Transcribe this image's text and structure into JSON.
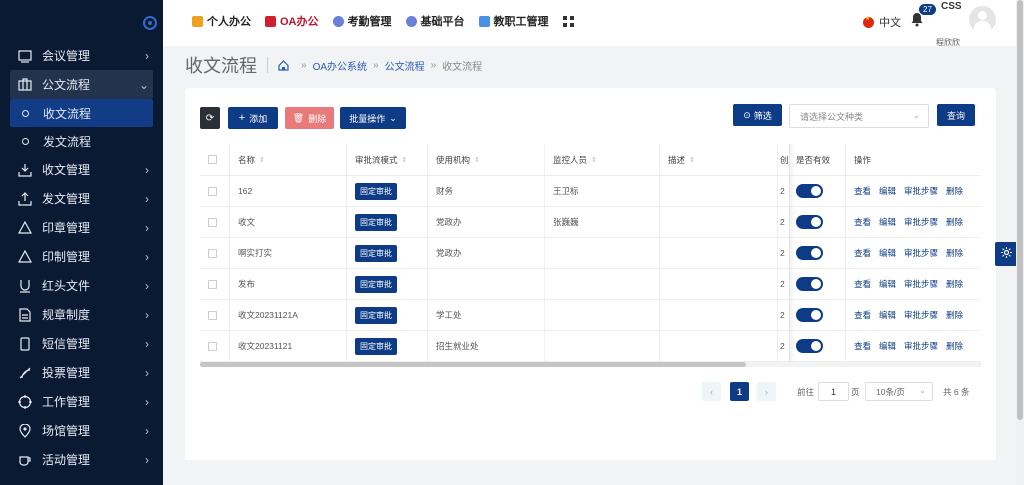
{
  "nav": {
    "items": [
      {
        "label": "个人办公",
        "icon": "briefcase-icon",
        "color": "#f0a020"
      },
      {
        "label": "OA办公",
        "icon": "office-icon",
        "color": "#d02030"
      },
      {
        "label": "考勤管理",
        "icon": "person-icon",
        "color": "#6a7fd8"
      },
      {
        "label": "基础平台",
        "icon": "platform-icon",
        "color": "#6a7fd8"
      },
      {
        "label": "教职工管理",
        "icon": "staff-icon",
        "color": "#4a90e2"
      }
    ],
    "language": "中文",
    "notifications": "27",
    "app_label": "CSS",
    "username": "程欣欣"
  },
  "sidebar": {
    "items": [
      {
        "label": "会议管理",
        "icon": "meeting-icon"
      },
      {
        "label": "公文流程",
        "icon": "document-flow-icon"
      },
      {
        "label": "收文管理",
        "icon": "inbox-icon"
      },
      {
        "label": "发文管理",
        "icon": "upload-icon"
      },
      {
        "label": "印章管理",
        "icon": "seal-icon"
      },
      {
        "label": "印制管理",
        "icon": "print-icon"
      },
      {
        "label": "红头文件",
        "icon": "red-header-icon"
      },
      {
        "label": "规章制度",
        "icon": "rules-icon"
      },
      {
        "label": "短信管理",
        "icon": "sms-icon"
      },
      {
        "label": "投票管理",
        "icon": "vote-icon"
      },
      {
        "label": "工作管理",
        "icon": "work-icon"
      },
      {
        "label": "场馆管理",
        "icon": "venue-icon"
      },
      {
        "label": "活动管理",
        "icon": "activity-icon"
      }
    ],
    "submenu": [
      "收文流程",
      "发文流程"
    ]
  },
  "page": {
    "title": "收文流程",
    "breadcrumb": [
      "OA办公系统",
      "公文流程",
      "收文流程"
    ]
  },
  "toolbar": {
    "add": "添加",
    "delete": "删除",
    "batch": "批量操作",
    "filter": "筛选",
    "select_placeholder": "请选择公文种类",
    "query": "查询"
  },
  "table": {
    "headers": [
      "名称",
      "审批流模式",
      "使用机构",
      "监控人员",
      "描述",
      "创",
      "是否有效",
      "操作"
    ],
    "rows": [
      {
        "name": "162",
        "mode": "固定审批",
        "org": "财务",
        "monitor": "王卫标",
        "desc": "",
        "c": "2"
      },
      {
        "name": "收文",
        "mode": "固定审批",
        "org": "党政办",
        "monitor": "张巍巍",
        "desc": "",
        "c": "2"
      },
      {
        "name": "啊实打实",
        "mode": "固定审批",
        "org": "党政办",
        "monitor": "",
        "desc": "",
        "c": "2"
      },
      {
        "name": "发布",
        "mode": "固定审批",
        "org": "",
        "monitor": "",
        "desc": "",
        "c": "2"
      },
      {
        "name": "收文20231121A",
        "mode": "固定审批",
        "org": "学工处",
        "monitor": "",
        "desc": "",
        "c": "2"
      },
      {
        "name": "收文20231121",
        "mode": "固定审批",
        "org": "招生就业处",
        "monitor": "",
        "desc": "",
        "c": "2"
      }
    ],
    "ops": [
      "查看",
      "编辑",
      "审批步骤",
      "删除"
    ]
  },
  "pagination": {
    "current": "1",
    "goto": "前往",
    "page_input": "1",
    "page_unit": "页",
    "page_size": "10条/页",
    "total": "共 6 条"
  }
}
